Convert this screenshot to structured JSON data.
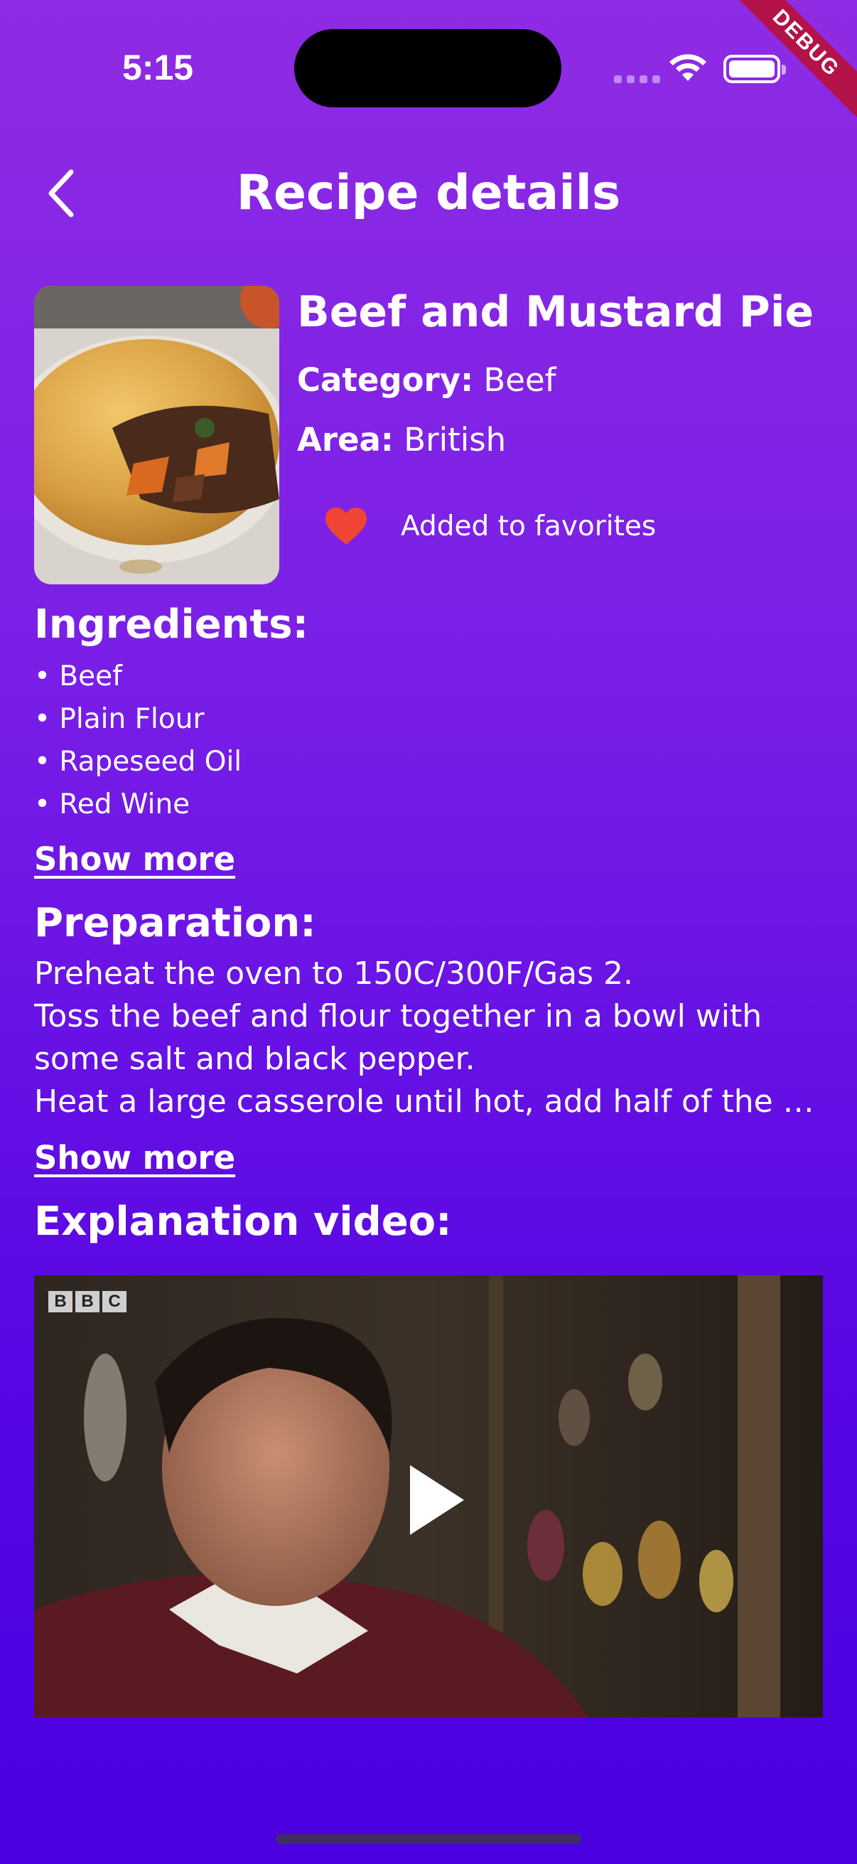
{
  "status_bar": {
    "time": "5:15"
  },
  "debug_label": "DEBUG",
  "header": {
    "title": "Recipe details"
  },
  "recipe": {
    "name": "Beef and Mustard Pie",
    "category_label": "Category:",
    "category": "Beef",
    "area_label": "Area:",
    "area": "British",
    "favorite_label": "Added to favorites",
    "favorite_color": "#f04434"
  },
  "ingredients": {
    "heading": "Ingredients:",
    "items": [
      "Beef",
      "Plain Flour",
      "Rapeseed Oil",
      "Red Wine"
    ],
    "show_more": "Show more"
  },
  "preparation": {
    "heading": "Preparation:",
    "lines": [
      "Preheat the oven to 150C/300F/Gas 2.",
      "Toss the beef and flour together in a bowl with",
      "some salt and black pepper.",
      "Heat a large casserole until hot, add half of the beef and fry until browned all over, then remove"
    ],
    "show_more": "Show more"
  },
  "video": {
    "heading": "Explanation video:",
    "watermark": [
      "B",
      "B",
      "C"
    ]
  },
  "colors": {
    "background_top": "#8f2be4",
    "background_bottom": "#4a00e0",
    "debug_banner": "#b4134a"
  }
}
